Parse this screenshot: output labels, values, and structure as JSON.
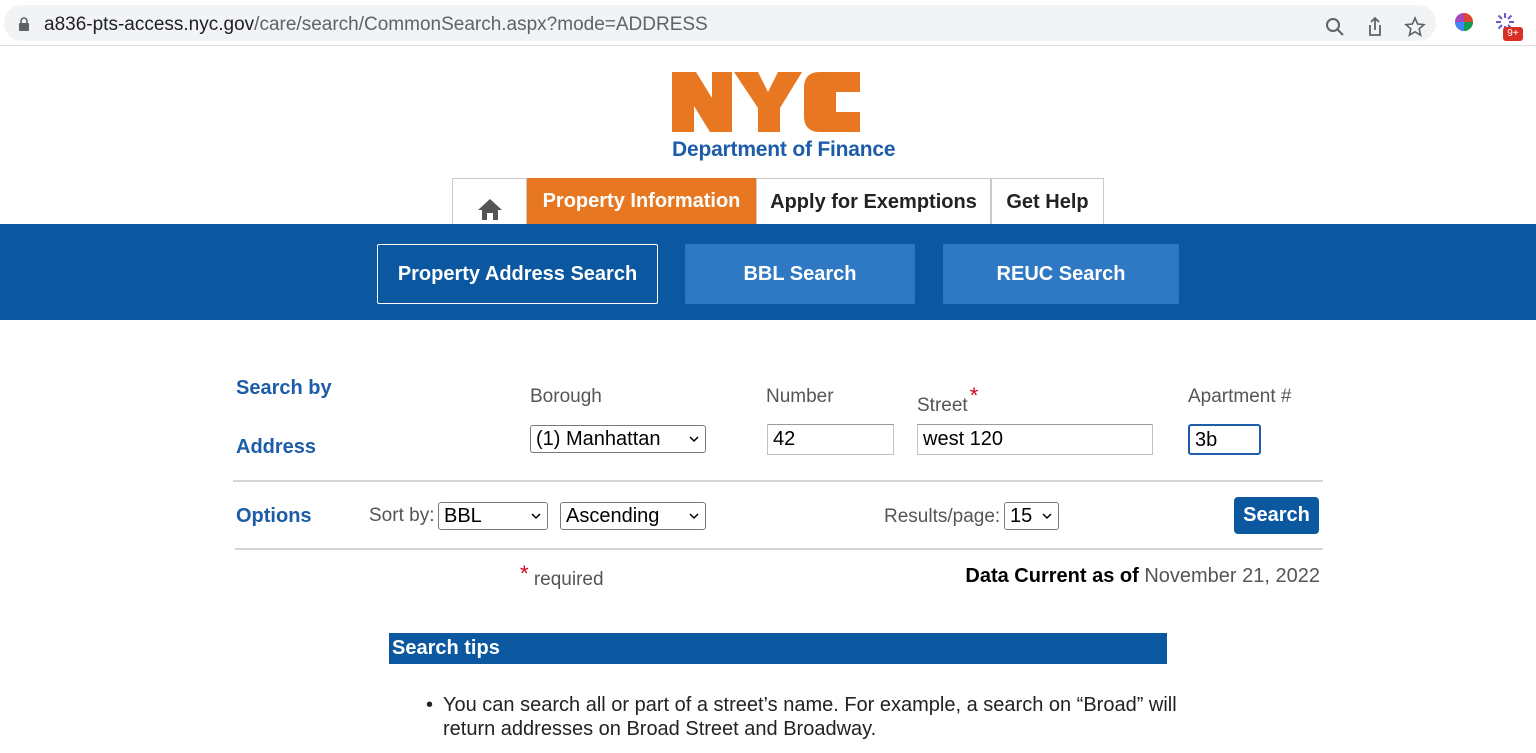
{
  "browser": {
    "url_host": "a836-pts-access.nyc.gov",
    "url_path": "/care/search/CommonSearch.aspx?mode=ADDRESS",
    "extension_badge": "9+"
  },
  "logo": {
    "department": "Department of Finance",
    "brand_text": "NYC",
    "brand_color": "#e87722"
  },
  "main_tabs": {
    "home_icon": "home-icon",
    "property_information": "Property Information",
    "apply_exemptions": "Apply for Exemptions",
    "get_help": "Get Help"
  },
  "sub_tabs": {
    "address_search": "Property Address Search",
    "bbl_search": "BBL Search",
    "reuc_search": "REUC Search"
  },
  "form": {
    "search_by": "Search by",
    "address": "Address",
    "borough_label": "Borough",
    "borough_value": "(1) Manhattan",
    "number_label": "Number",
    "number_value": "42",
    "street_label": "Street",
    "street_value": "west 120",
    "apartment_label": "Apartment #",
    "apartment_value": "3b",
    "required_star": "*"
  },
  "options": {
    "label": "Options",
    "sort_by_label": "Sort by:",
    "sort_field": "BBL",
    "sort_order": "Ascending",
    "results_per_page_label": "Results/page:",
    "results_per_page": "15",
    "search_button": "Search"
  },
  "footer": {
    "required_note": "required",
    "data_current_label": "Data Current as of",
    "data_current_date": "November 21, 2022"
  },
  "tips": {
    "header": "Search tips",
    "items": [
      "You can search all or part of a street’s name. For example, a search on “Broad” will return addresses on Broad Street and Broadway."
    ]
  }
}
